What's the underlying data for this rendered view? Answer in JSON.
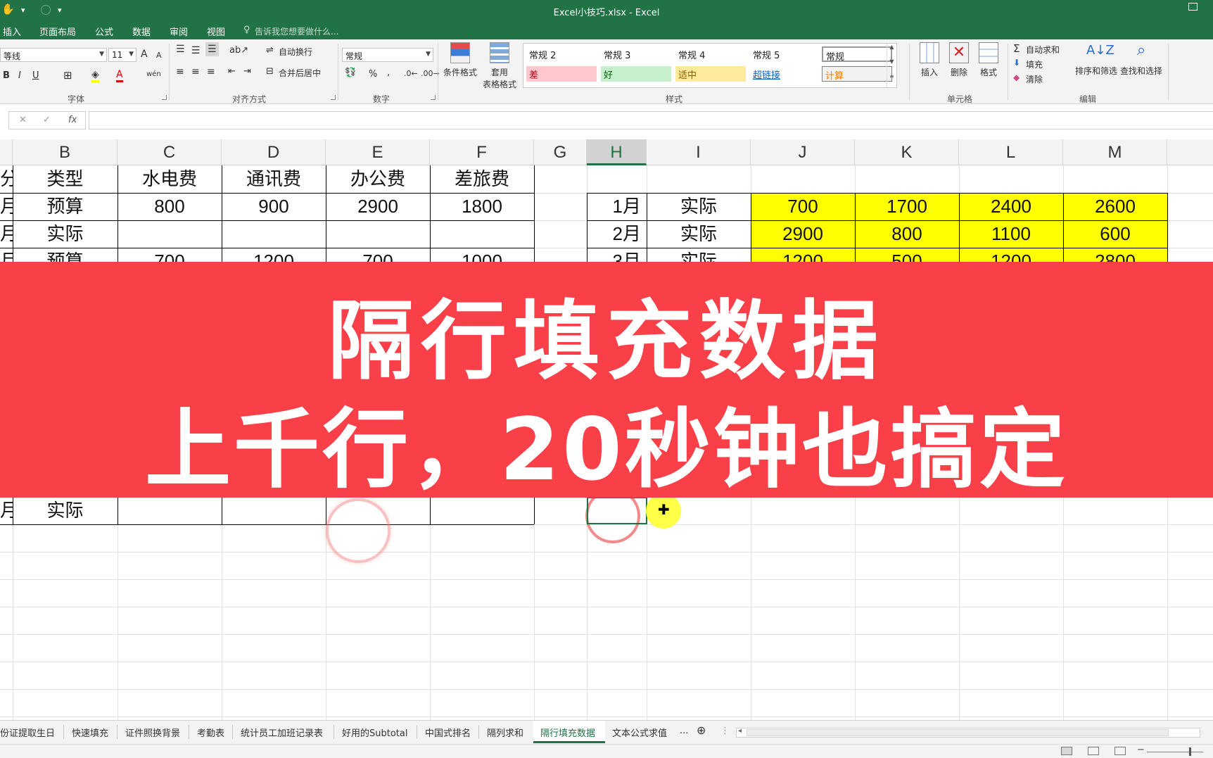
{
  "window": {
    "title": "Excel小技巧.xlsx - Excel"
  },
  "ribbon_tabs": [
    "插入",
    "页面布局",
    "公式",
    "数据",
    "审阅",
    "视图"
  ],
  "tell_me": "告诉我您想要做什么...",
  "font": {
    "name": "等线",
    "size": "11",
    "bold": "B",
    "italic": "I",
    "underline": "U",
    "grow": "A",
    "shrink": "A"
  },
  "alignment": {
    "wrap_text": "自动换行",
    "merge_center": "合并后居中"
  },
  "number": {
    "format": "常规",
    "percent": "%",
    "comma": ","
  },
  "big_buttons": {
    "conditional_format": "条件格式",
    "format_table_line1": "套用",
    "format_table_line2": "表格格式"
  },
  "styles": [
    {
      "label": "常规 2",
      "bg": "#ffffff",
      "color": "#000000"
    },
    {
      "label": "常规 3",
      "bg": "#ffffff",
      "color": "#000000"
    },
    {
      "label": "常规 4",
      "bg": "#ffffff",
      "color": "#000000"
    },
    {
      "label": "常规 5",
      "bg": "#ffffff",
      "color": "#000000"
    },
    {
      "label": "常规",
      "bg": "#ffffff",
      "color": "#000000"
    },
    {
      "label": "差",
      "bg": "#ffc7ce",
      "color": "#9c0006"
    },
    {
      "label": "好",
      "bg": "#c6efce",
      "color": "#006100"
    },
    {
      "label": "适中",
      "bg": "#ffeb9c",
      "color": "#9c5700"
    },
    {
      "label": "超链接",
      "bg": "#ffffff",
      "color": "#0563c1"
    },
    {
      "label": "计算",
      "bg": "#f2f2f2",
      "color": "#fa7d00"
    }
  ],
  "cells_group": {
    "insert": "插入",
    "delete": "删除",
    "format": "格式"
  },
  "editing_group": {
    "autosum": "自动求和",
    "fill": "填充",
    "clear": "清除",
    "sort_filter": "排序和筛选",
    "find_select": "查找和选择"
  },
  "group_labels": {
    "font": "字体",
    "alignment": "对齐方式",
    "number": "数字",
    "styles": "样式",
    "cells": "单元格",
    "editing": "编辑"
  },
  "formula_bar": {
    "cancel": "✕",
    "enter": "✓",
    "fx": "fx",
    "value": ""
  },
  "columns": [
    "B",
    "C",
    "D",
    "E",
    "F",
    "G",
    "H",
    "I",
    "J",
    "K",
    "L",
    "M"
  ],
  "left_table": {
    "headers": [
      "类型",
      "水电费",
      "通讯费",
      "办公费",
      "差旅费"
    ],
    "rows": [
      {
        "a": "月",
        "b": "预算",
        "c": "800",
        "d": "900",
        "e": "2900",
        "f": "1800"
      },
      {
        "a": "月",
        "b": "实际",
        "c": "",
        "d": "",
        "e": "",
        "f": ""
      },
      {
        "a": "月",
        "b": "预算",
        "c": "700",
        "d": "1200",
        "e": "700",
        "f": "1000"
      }
    ],
    "last_row": {
      "a": "月",
      "b": "实际"
    }
  },
  "right_table": {
    "rows": [
      {
        "h": "1月",
        "i": "实际",
        "j": "700",
        "k": "1700",
        "l": "2400",
        "m": "2600"
      },
      {
        "h": "2月",
        "i": "实际",
        "j": "2900",
        "k": "800",
        "l": "1100",
        "m": "600"
      },
      {
        "h": "3月",
        "i": "实际",
        "j": "1200",
        "k": "500",
        "l": "1200",
        "m": "2800"
      }
    ]
  },
  "banner": {
    "line1": "隔行填充数据",
    "line2": "上千行，20秒钟也搞定"
  },
  "sheet_tabs": [
    "份证提取生日",
    "快速填充",
    "证件照换背景",
    "考勤表",
    "统计员工加班记录表",
    "好用的Subtotal",
    "中国式排名",
    "隔列求和",
    "隔行填充数据",
    "文本公式求值",
    "..."
  ],
  "active_sheet": "隔行填充数据",
  "icons": {
    "cursor": "plus-cursor-icon",
    "add_sheet": "⊕"
  }
}
